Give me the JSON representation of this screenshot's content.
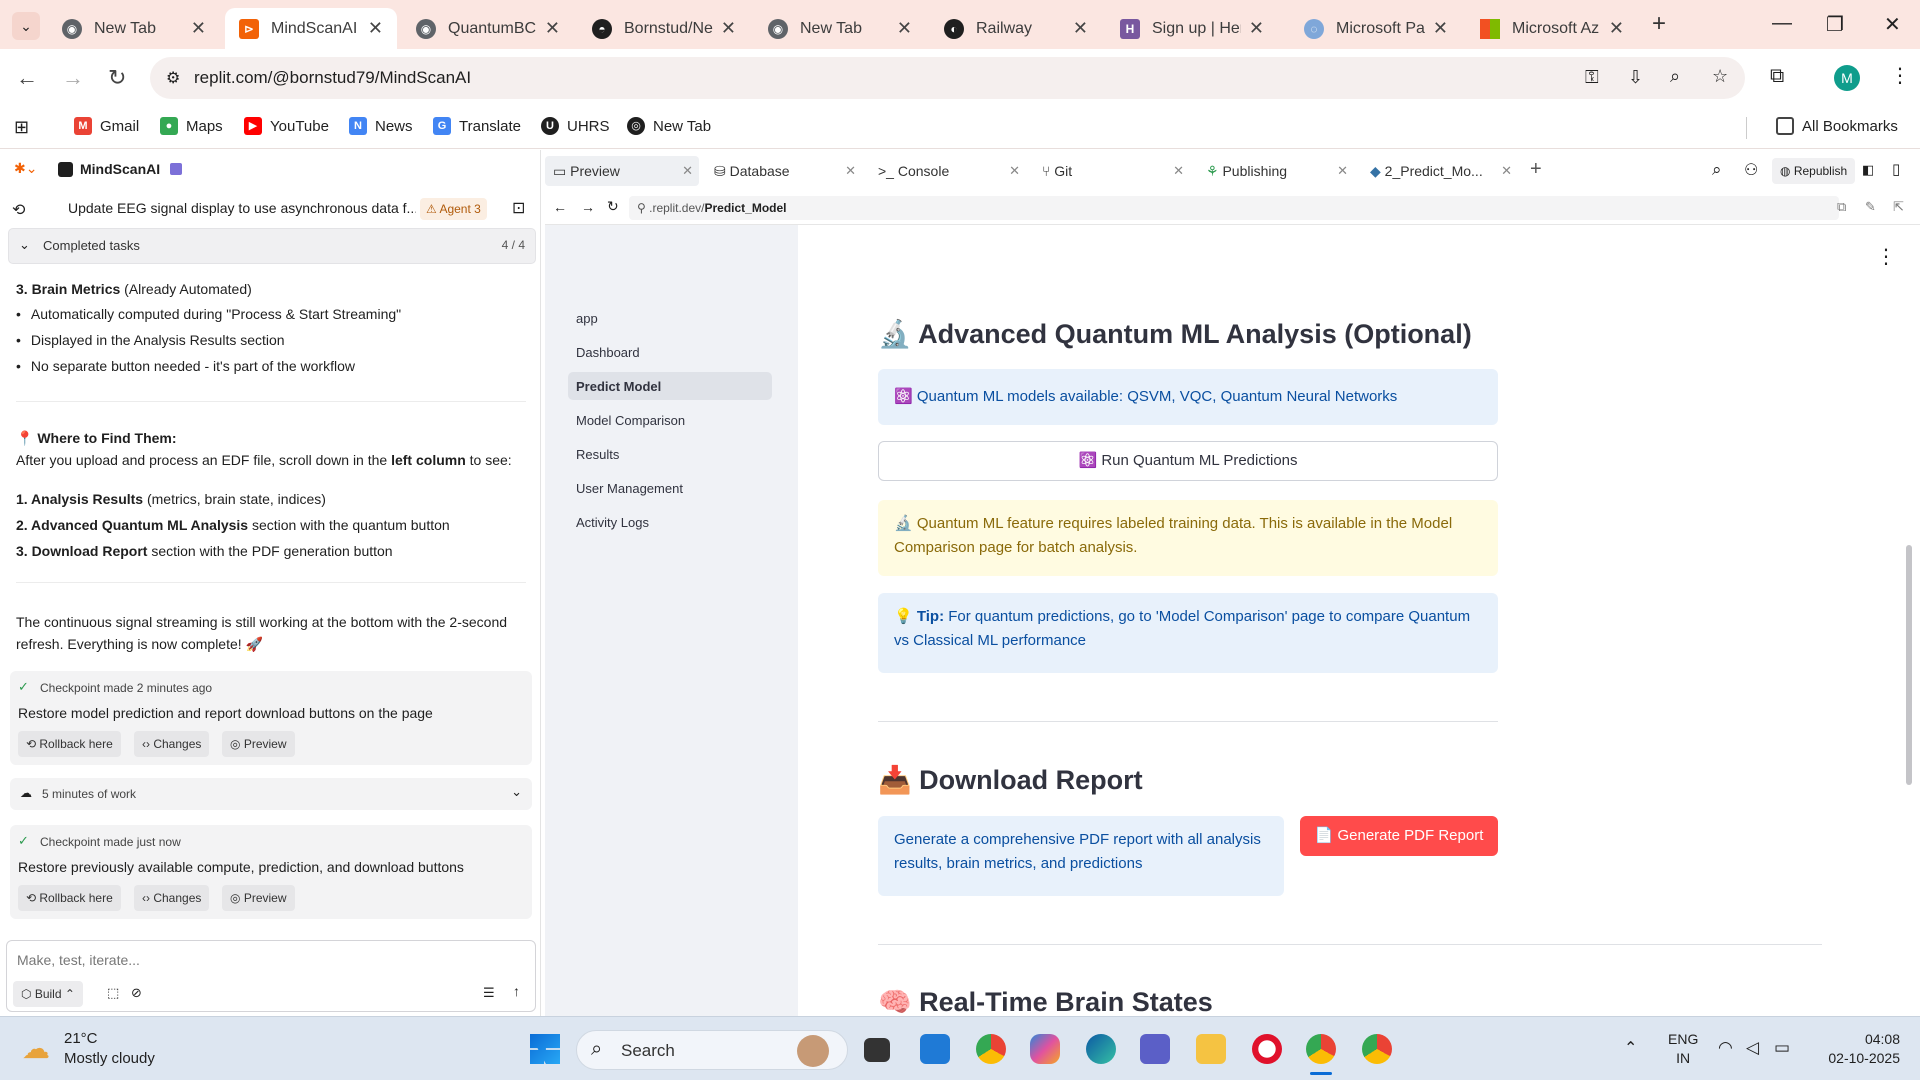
{
  "browser": {
    "tabs": [
      {
        "title": "New Tab",
        "icon": "chrome-icon",
        "color": "#5f6368"
      },
      {
        "title": "MindScanAI - ",
        "icon": "replit-icon",
        "color": "#f26207"
      },
      {
        "title": "QuantumBCI",
        "icon": "chrome-icon",
        "color": "#5f6368"
      },
      {
        "title": "Bornstud/Ne",
        "icon": "github-icon",
        "color": "#1f1f1f"
      },
      {
        "title": "New Tab",
        "icon": "chrome-icon",
        "color": "#5f6368"
      },
      {
        "title": "Railway",
        "icon": "railway-icon",
        "color": "#1f1f1f"
      },
      {
        "title": "Sign up | Her",
        "icon": "heroku-icon",
        "color": "#79589f"
      },
      {
        "title": "Microsoft Par",
        "icon": "partner-icon",
        "color": "#7fa7d9"
      },
      {
        "title": "Microsoft Az",
        "icon": "microsoft-icon",
        "color": "#f25022"
      }
    ],
    "url": "replit.com/@bornstud79/MindScanAI",
    "avatar_letter": "M",
    "bookmarks": [
      {
        "label": "Gmail",
        "color": "#ea4335",
        "glyph": "M"
      },
      {
        "label": "Maps",
        "color": "#34a853",
        "glyph": "●"
      },
      {
        "label": "YouTube",
        "color": "#ff0000",
        "glyph": "▶"
      },
      {
        "label": "News",
        "color": "#4285f4",
        "glyph": "N"
      },
      {
        "label": "Translate",
        "color": "#4285f4",
        "glyph": "G"
      },
      {
        "label": "UHRS",
        "color": "#1f1f1f",
        "glyph": "U"
      },
      {
        "label": "New Tab",
        "color": "#1f1f1f",
        "glyph": "◎"
      }
    ],
    "all_bookmarks": "All Bookmarks"
  },
  "replit": {
    "project": "MindScanAI",
    "thread_title": "Update EEG signal display to use asynchronous data f...",
    "agent_badge": "Agent 3",
    "completed_tasks": "Completed tasks",
    "completed_count": "4 / 4",
    "chat": {
      "item3_title": "3. Brain Metrics",
      "item3_rest": "(Already Automated)",
      "bullets": [
        "Automatically computed during \"Process & Start Streaming\"",
        "Displayed in the Analysis Results section",
        "No separate button needed - it's part of the workflow"
      ],
      "where_title": "📍 Where to Find Them:",
      "where_text_a": "After you upload and process an EDF file, scroll down in the ",
      "where_text_b": "left column",
      "where_text_c": " to see:",
      "list": [
        {
          "bold": "1. Analysis Results",
          "rest": " (metrics, brain state, indices)"
        },
        {
          "bold": "2. Advanced Quantum ML Analysis",
          "rest": " section with the quantum button"
        },
        {
          "bold": "3. Download Report",
          "rest": " section with the PDF generation button"
        }
      ],
      "closing_a": "The continuous signal streaming is still working at the bottom with the 2-second",
      "closing_b": "refresh. Everything is now complete! 🚀"
    },
    "checkpoint1": {
      "when": "Checkpoint made 2 minutes ago",
      "text": "Restore model prediction and report download buttons on the page"
    },
    "work": "5 minutes of work",
    "checkpoint2": {
      "when": "Checkpoint made just now",
      "text": "Restore previously available compute, prediction, and download buttons"
    },
    "btn_rollback": "Rollback here",
    "btn_changes": "Changes",
    "btn_preview": "Preview",
    "input_placeholder": "Make, test, iterate...",
    "build": "Build",
    "tabs": [
      "Preview",
      "Database",
      "Console",
      "Git",
      "Publishing",
      "2_Predict_Mo..."
    ],
    "republish": "Republish",
    "preview_url_a": ".replit.dev/",
    "preview_url_b": "Predict_Model"
  },
  "app": {
    "nav": [
      "app",
      "Dashboard",
      "Predict Model",
      "Model Comparison",
      "Results",
      "User Management",
      "Activity Logs"
    ],
    "qml_title": "🔬 Advanced Quantum ML Analysis (Optional)",
    "qml_info": "⚛️ Quantum ML models available: QSVM, VQC, Quantum Neural Networks",
    "qml_button": "⚛️ Run Quantum ML Predictions",
    "qml_warn": "🔬 Quantum ML feature requires labeled training data. This is available in the Model Comparison page for batch analysis.",
    "tip_label": "💡 Tip:",
    "tip_text": " For quantum predictions, go to 'Model Comparison' page to compare Quantum vs Classical ML performance",
    "report_title": "📥 Download Report",
    "report_info": "Generate a comprehensive PDF report with all analysis results, brain metrics, and predictions",
    "report_button": "📄 Generate PDF Report",
    "states_title": "🧠 Real-Time Brain States"
  },
  "taskbar": {
    "temp": "21°C",
    "weather": "Mostly cloudy",
    "search": "Search",
    "lang1": "ENG",
    "lang2": "IN",
    "time": "04:08",
    "date": "02-10-2025"
  }
}
